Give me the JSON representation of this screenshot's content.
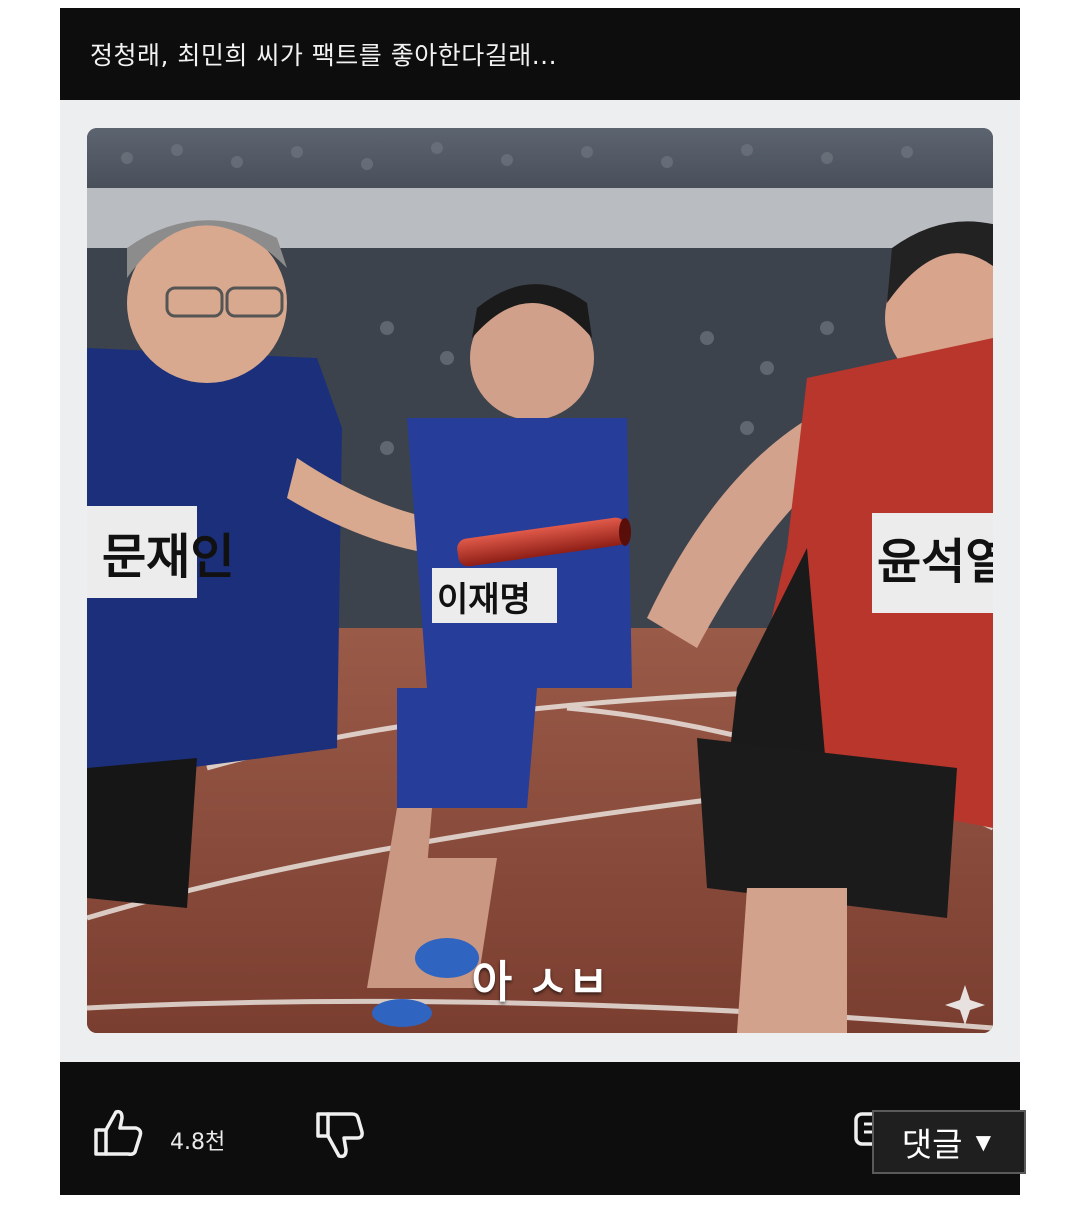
{
  "post": {
    "caption": "정청래, 최민희 씨가 팩트를 좋아한다길래...",
    "subtitle": "아 ㅅㅂ"
  },
  "image": {
    "bib_left": "문재인",
    "bib_middle": "이재명",
    "bib_right": "윤석열"
  },
  "actions": {
    "like_icon": "thumbs-up-icon",
    "like_count": "4.8천",
    "dislike_icon": "thumbs-down-icon",
    "comment_icon": "comment-icon",
    "comment_label": "댓글",
    "comment_arrow": "▼"
  },
  "colors": {
    "bar_background": "#0d0d0d",
    "card_background": "#eceef0",
    "track": "#8a4a3a",
    "left_shirt": "#1c2f7a",
    "right_singlet": "#b8362c"
  }
}
